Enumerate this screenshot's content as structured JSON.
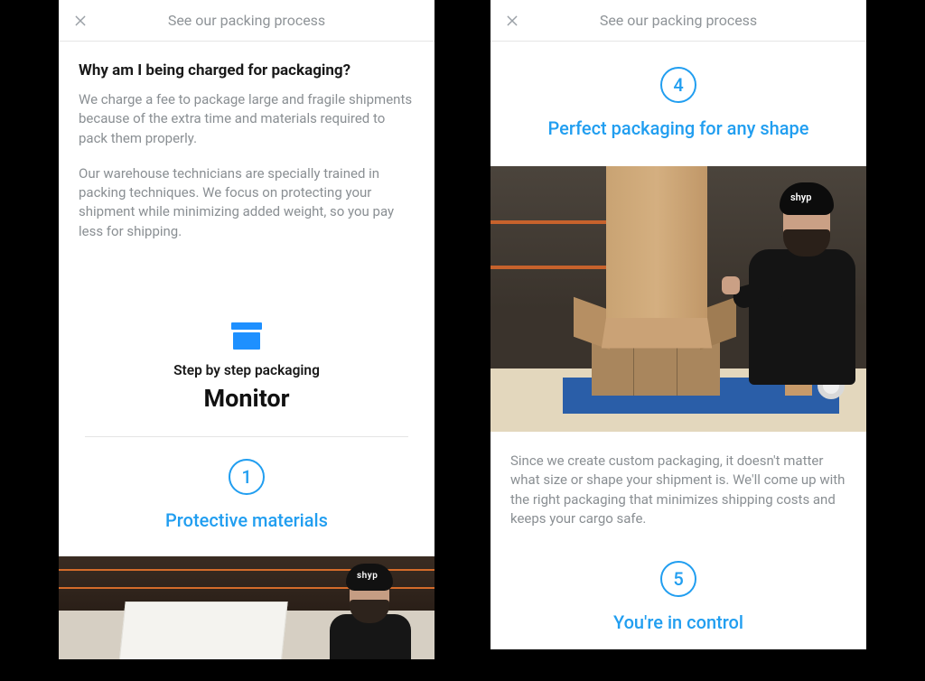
{
  "header": {
    "title": "See our packing process"
  },
  "left": {
    "question": "Why am I being charged for packaging?",
    "para1": "We charge a fee to package large and fragile shipments because of the extra time and materials required to pack them properly.",
    "para2": "Our warehouse technicians are specially trained in packing techniques. We focus on protecting your shipment while minimizing added weight, so you pay less for shipping.",
    "intro_sub": "Step by step packaging",
    "intro_big": "Monitor",
    "step1_num": "1",
    "step1_title": "Protective materials",
    "worker_logo": "shyp"
  },
  "right": {
    "step4_num": "4",
    "step4_title": "Perfect packaging for any shape",
    "desc": "Since we create custom packaging, it doesn't matter what size or shape your shipment is. We'll come up with the right packaging that minimizes shipping costs and keeps your cargo safe.",
    "step5_num": "5",
    "step5_title": "You're in control",
    "worker_logo": "shyp"
  }
}
